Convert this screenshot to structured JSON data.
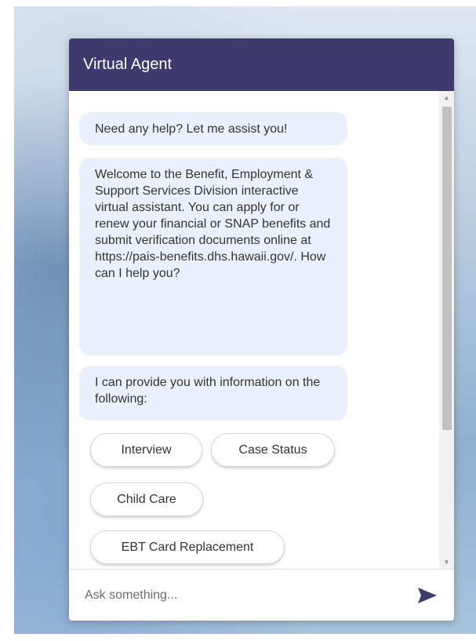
{
  "header": {
    "title": "Virtual Agent"
  },
  "messages": [
    {
      "text": "Need any help? Let me assist you!"
    },
    {
      "text": "Welcome to the Benefit, Employment & Support Services Division interactive virtual assistant. You can apply for or renew your financial or SNAP benefits and submit verification documents online at https://pais-benefits.dhs.hawaii.gov/. How can I help you?"
    },
    {
      "text": "I can provide you with information on the following:"
    }
  ],
  "quick_replies": [
    {
      "label": "Interview"
    },
    {
      "label": "Case Status"
    },
    {
      "label": "Child Care"
    },
    {
      "label": "EBT Card Replacement"
    }
  ],
  "input": {
    "placeholder": "Ask something..."
  },
  "icons": {
    "send": "send-icon",
    "scroll_up": "scroll-up-arrow-icon",
    "scroll_down": "scroll-down-arrow-icon"
  },
  "colors": {
    "header_bg": "#3d3a6e",
    "bubble_bg": "#eaf1fc",
    "send_icon": "#3d3a6e"
  }
}
